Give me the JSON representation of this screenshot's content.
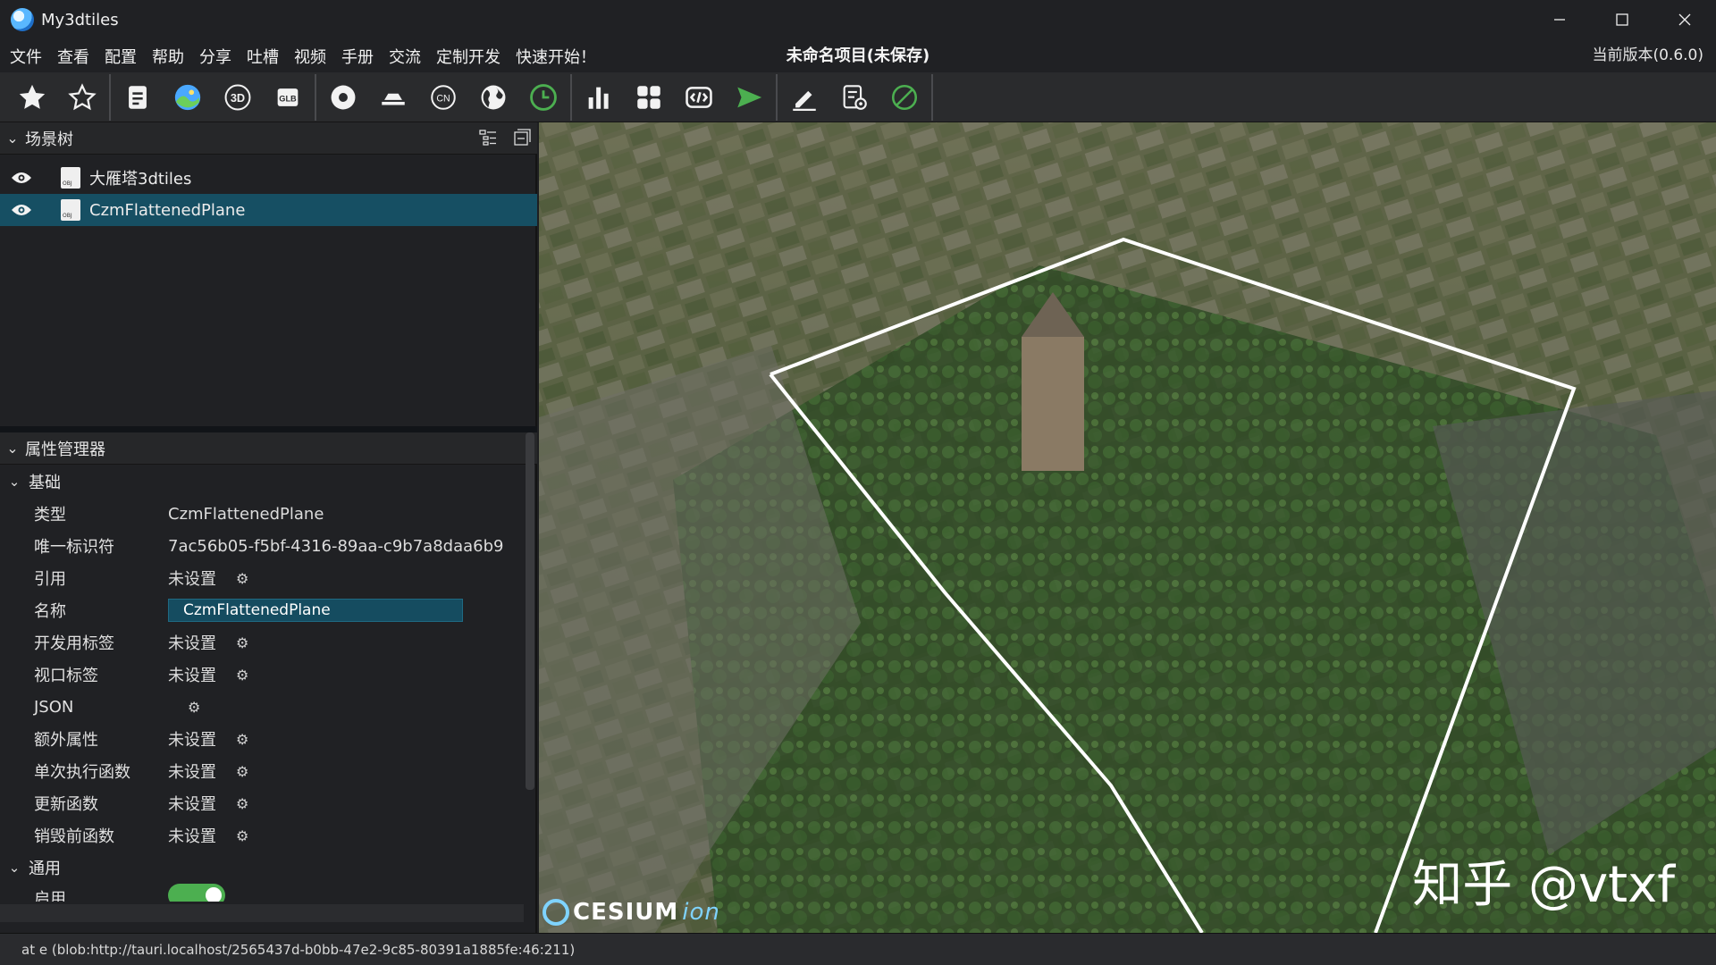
{
  "window": {
    "title": "My3dtiles",
    "controls": [
      "minimize-icon",
      "maximize-icon",
      "close-icon"
    ]
  },
  "menu": {
    "items": [
      "文件",
      "查看",
      "配置",
      "帮助",
      "分享",
      "吐槽",
      "视频",
      "手册",
      "交流",
      "定制开发",
      "快速开始！"
    ],
    "project_title": "未命名项目(未保存)",
    "version": "当前版本(0.6.0)"
  },
  "toolbar": {
    "groups": [
      [
        "star-filled-icon",
        "star-outline-icon"
      ],
      [
        "document-icon",
        "imagery-icon",
        "3d-icon",
        "glb-icon"
      ],
      [
        "target-icon",
        "terrain-icon",
        "cn-icon",
        "globe-icon",
        "clock-icon"
      ],
      [
        "bar-chart-icon",
        "grid-icon",
        "code-icon",
        "play-icon"
      ],
      [
        "edit-icon",
        "settings-doc-icon",
        "disable-icon"
      ]
    ],
    "accent_green": "#4caf50"
  },
  "scene_tree": {
    "title": "场景树",
    "items": [
      {
        "label": "大雁塔3dtiles",
        "selected": false
      },
      {
        "label": "CzmFlattenedPlane",
        "selected": true
      }
    ]
  },
  "properties": {
    "title": "属性管理器",
    "group_basic": "基础",
    "rows": [
      {
        "name": "类型",
        "value": "CzmFlattenedPlane"
      },
      {
        "name": "唯一标识符",
        "value": "7ac56b05-f5bf-4316-89aa-c9b7a8daa6b9"
      },
      {
        "name": "引用",
        "value": "未设置"
      },
      {
        "name": "名称",
        "value": "CzmFlattenedPlane"
      },
      {
        "name": "开发用标签",
        "value": "未设置"
      },
      {
        "name": "视口标签",
        "value": "未设置"
      },
      {
        "name": "JSON",
        "value": ""
      },
      {
        "name": "额外属性",
        "value": "未设置"
      },
      {
        "name": "单次执行函数",
        "value": "未设置"
      },
      {
        "name": "更新函数",
        "value": "未设置"
      },
      {
        "name": "销毁前函数",
        "value": "未设置"
      }
    ],
    "group_common": "通用",
    "enable_label": "启用",
    "enabled": true
  },
  "viewport": {
    "logo_main": "CESIUM",
    "logo_sub": "ion",
    "watermark": "知乎 @vtxf"
  },
  "status": {
    "text": "at e (blob:http://tauri.localhost/2565437d-b0bb-47e2-9c85-80391a1885fe:46:211)"
  }
}
